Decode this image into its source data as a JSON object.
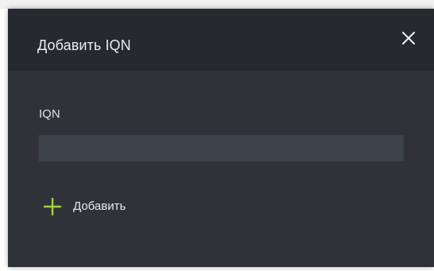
{
  "dialog": {
    "title": "Добавить IQN",
    "close_icon": "close-icon"
  },
  "form": {
    "iqn_label": "IQN",
    "iqn_value": "",
    "iqn_placeholder": ""
  },
  "actions": {
    "add_label": "Добавить",
    "add_icon": "plus-icon",
    "accent_color": "#a3d33b"
  },
  "colors": {
    "dialog_background": "#2f3339",
    "header_background": "#262a30",
    "input_background": "#3d434b",
    "text": "#e9edf1"
  }
}
